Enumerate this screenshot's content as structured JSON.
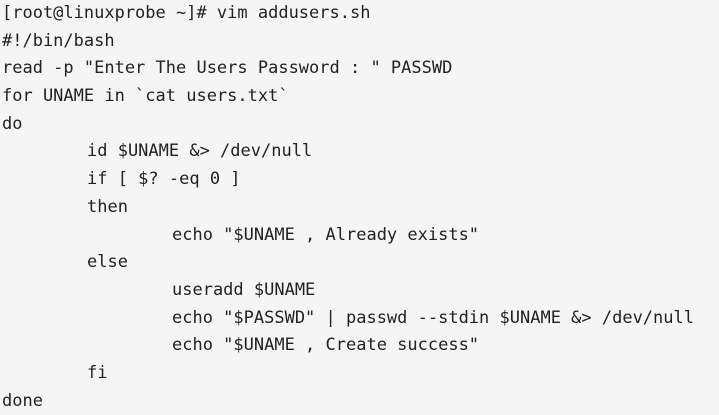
{
  "terminal": {
    "lines": [
      "[root@linuxprobe ~]# vim addusers.sh",
      "#!/bin/bash",
      "read -p \"Enter The Users Password : \" PASSWD",
      "for UNAME in `cat users.txt`",
      "do",
      "id $UNAME &> /dev/null",
      "if [ $? -eq 0 ]",
      "then",
      "echo \"$UNAME , Already exists\"",
      "else",
      "useradd $UNAME",
      "echo \"$PASSWD\" | passwd --stdin $UNAME &> /dev/null",
      "echo \"$UNAME , Create success\"",
      "fi",
      "done"
    ]
  }
}
